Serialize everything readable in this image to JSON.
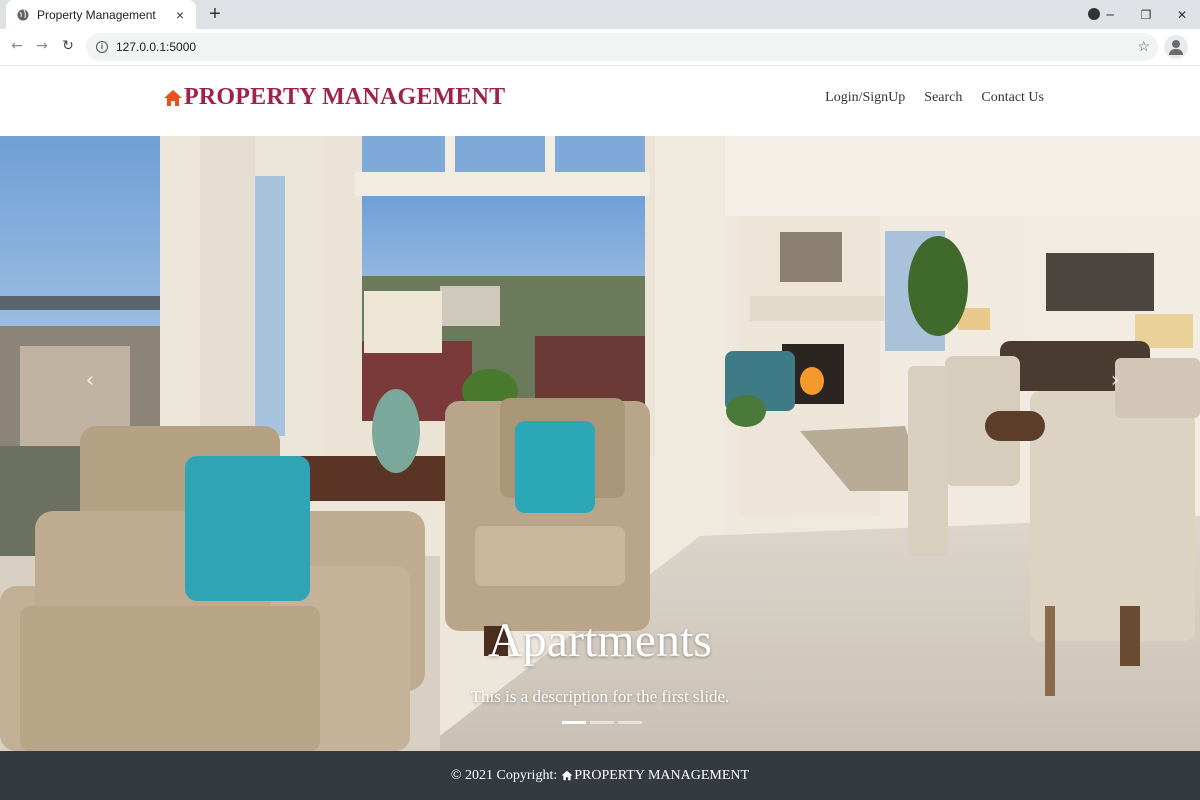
{
  "browser": {
    "tab_title": "Property Management",
    "tab_close": "×",
    "new_tab": "+",
    "url": "127.0.0.1:5000"
  },
  "site": {
    "brand": "PROPERTY MANAGEMENT",
    "nav": [
      {
        "label": "Login/SignUp"
      },
      {
        "label": "Search"
      },
      {
        "label": "Contact Us"
      }
    ]
  },
  "carousel": {
    "slides": [
      {
        "title": "Apartments",
        "description": "This is a description for the first slide."
      }
    ],
    "active_index": 0,
    "indicator_count": 3
  },
  "footer": {
    "copyright": "© 2021 Copyright:",
    "brand": "PROPERTY MANAGEMENT"
  },
  "colors": {
    "brand": "#a0224c",
    "footer_bg": "#343a40"
  }
}
